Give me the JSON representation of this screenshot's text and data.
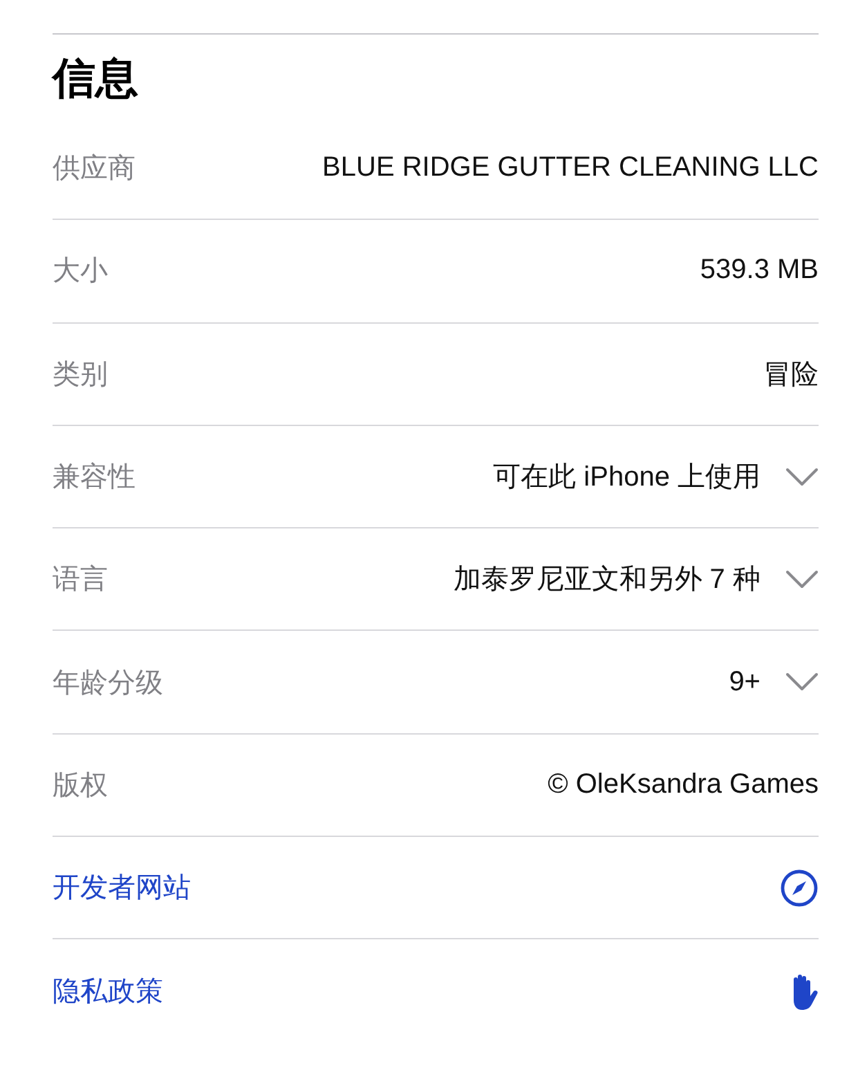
{
  "section": {
    "title": "信息"
  },
  "rows": [
    {
      "kind": "info",
      "label": "供应商",
      "value": "BLUE RIDGE GUTTER CLEANING LLC",
      "expandable": false
    },
    {
      "kind": "info",
      "label": "大小",
      "value": "539.3 MB",
      "expandable": false
    },
    {
      "kind": "info",
      "label": "类别",
      "value": "冒险",
      "expandable": false
    },
    {
      "kind": "info",
      "label": "兼容性",
      "value": "可在此 iPhone 上使用",
      "expandable": true
    },
    {
      "kind": "info",
      "label": "语言",
      "value": "加泰罗尼亚文和另外 7 种",
      "expandable": true
    },
    {
      "kind": "info",
      "label": "年龄分级",
      "value": "9+",
      "expandable": true
    },
    {
      "kind": "info",
      "label": "版权",
      "value": "© OleKsandra Games",
      "expandable": false
    },
    {
      "kind": "link",
      "label": "开发者网站"
    },
    {
      "kind": "link",
      "label": "隐私政策"
    }
  ]
}
